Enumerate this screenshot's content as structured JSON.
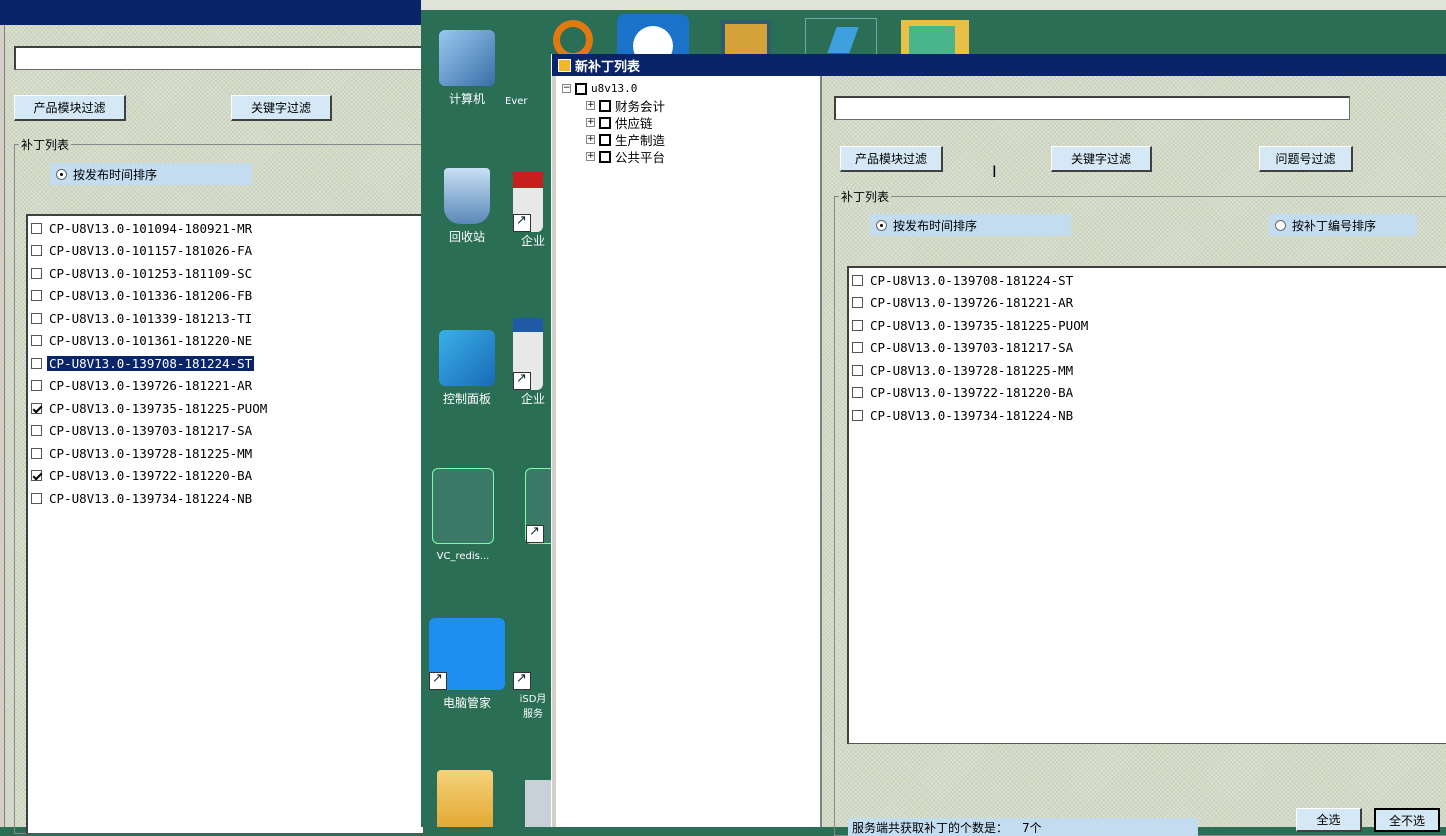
{
  "back_window": {
    "buttons": {
      "module_filter": "产品模块过滤",
      "keyword_filter": "关键字过滤"
    },
    "group_title": "补丁列表",
    "sort_by_time": "按发布时间排序",
    "patches": [
      {
        "id": "CP-U8V13.0-101094-180921-MR",
        "checked": false,
        "selected": false
      },
      {
        "id": "CP-U8V13.0-101157-181026-FA",
        "checked": false,
        "selected": false
      },
      {
        "id": "CP-U8V13.0-101253-181109-SC",
        "checked": false,
        "selected": false
      },
      {
        "id": "CP-U8V13.0-101336-181206-FB",
        "checked": false,
        "selected": false
      },
      {
        "id": "CP-U8V13.0-101339-181213-TI",
        "checked": false,
        "selected": false
      },
      {
        "id": "CP-U8V13.0-101361-181220-NE",
        "checked": false,
        "selected": false
      },
      {
        "id": "CP-U8V13.0-139708-181224-ST",
        "checked": false,
        "selected": true
      },
      {
        "id": "CP-U8V13.0-139726-181221-AR",
        "checked": false,
        "selected": false
      },
      {
        "id": "CP-U8V13.0-139735-181225-PUOM",
        "checked": true,
        "selected": false
      },
      {
        "id": "CP-U8V13.0-139703-181217-SA",
        "checked": false,
        "selected": false
      },
      {
        "id": "CP-U8V13.0-139728-181225-MM",
        "checked": false,
        "selected": false
      },
      {
        "id": "CP-U8V13.0-139722-181220-BA",
        "checked": true,
        "selected": false
      },
      {
        "id": "CP-U8V13.0-139734-181224-NB",
        "checked": false,
        "selected": false
      }
    ]
  },
  "desktop": {
    "icons": [
      {
        "label": "计算机"
      },
      {
        "label": "Ever"
      },
      {
        "label": "回收站"
      },
      {
        "label": "企业"
      },
      {
        "label": "控制面板"
      },
      {
        "label": "企业"
      },
      {
        "label": "VC_redis..."
      },
      {
        "label": "电脑管家"
      },
      {
        "label": "iSD月\n服务"
      }
    ]
  },
  "front_window": {
    "title": "新补丁列表",
    "tree": {
      "root": "u8v13.0",
      "children": [
        "财务会计",
        "供应链",
        "生产制造",
        "公共平台"
      ]
    },
    "buttons": {
      "module_filter": "产品模块过滤",
      "keyword_filter": "关键字过滤",
      "issue_filter": "问题号过滤",
      "select_all": "全选",
      "deselect_all": "全不选"
    },
    "group_title": "补丁列表",
    "sort_by_time": "按发布时间排序",
    "sort_by_number": "按补丁编号排序",
    "patches": [
      {
        "id": "CP-U8V13.0-139708-181224-ST",
        "checked": false
      },
      {
        "id": "CP-U8V13.0-139726-181221-AR",
        "checked": false
      },
      {
        "id": "CP-U8V13.0-139735-181225-PUOM",
        "checked": false
      },
      {
        "id": "CP-U8V13.0-139703-181217-SA",
        "checked": false
      },
      {
        "id": "CP-U8V13.0-139728-181225-MM",
        "checked": false
      },
      {
        "id": "CP-U8V13.0-139722-181220-BA",
        "checked": false
      },
      {
        "id": "CP-U8V13.0-139734-181224-NB",
        "checked": false
      }
    ],
    "status_label": "服务端共获取补丁的个数是：",
    "status_value": "7个"
  },
  "colors": {
    "desktop": "#2a6e55",
    "titlebar": "#0a246a",
    "button": "#d4e8f5",
    "selection": "#0a246a"
  }
}
